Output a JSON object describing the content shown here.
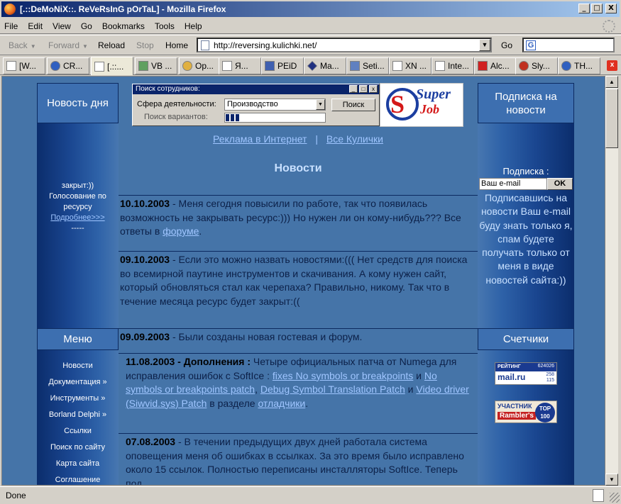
{
  "window": {
    "title": "[.::DeMoNiX::. ReVeRsInG pOrTaL] - Mozilla Firefox",
    "minimize": "_",
    "maximize": "□",
    "close": "X"
  },
  "menu": [
    "File",
    "Edit",
    "View",
    "Go",
    "Bookmarks",
    "Tools",
    "Help"
  ],
  "nav": {
    "back": "Back",
    "forward": "Forward",
    "reload": "Reload",
    "stop": "Stop",
    "home": "Home",
    "url": "http://reversing.kulichki.net/",
    "go": "Go",
    "search_placeholder": ""
  },
  "tabs": [
    {
      "label": "[W...",
      "icon": "page-icon"
    },
    {
      "label": "CR...",
      "icon": "globe-icon"
    },
    {
      "label": "[.::...",
      "icon": "page-icon",
      "active": true
    },
    {
      "label": "VB ...",
      "icon": "vb-icon"
    },
    {
      "label": "Op...",
      "icon": "gear-icon"
    },
    {
      "label": "Я...",
      "icon": "page-icon"
    },
    {
      "label": "PEiD",
      "icon": "app-icon"
    },
    {
      "label": "Ma...",
      "icon": "diamond-icon"
    },
    {
      "label": "Seti...",
      "icon": "telescope-icon"
    },
    {
      "label": "XN ...",
      "icon": "page-icon"
    },
    {
      "label": "Inte...",
      "icon": "page-icon"
    },
    {
      "label": "Alc...",
      "icon": "pdf-icon"
    },
    {
      "label": "Sly...",
      "icon": "firefox-icon"
    },
    {
      "label": "TH...",
      "icon": "globe-icon"
    }
  ],
  "status": "Done",
  "page": {
    "left": {
      "news_day": "Новость дня",
      "poll_lines": [
        "закрыт:))",
        "Голосование по",
        "ресурсу"
      ],
      "poll_more": "Подробнее>>>",
      "poll_sep": "-----",
      "menu_title": "Меню",
      "menu_items": [
        "Новости",
        "Документация »",
        "Инструменты »",
        "Borland Delphi »",
        "Ссылки",
        "Поиск по сайту",
        "Карта сайта",
        "Соглашение"
      ]
    },
    "widget": {
      "title": "Поиск сотрудников:",
      "sphere_label": "Сфера деятельности:",
      "sphere_value": "Производство",
      "search_button": "Поиск",
      "variants_label": "Поиск вариантов:",
      "progress": 0.14
    },
    "logo": {
      "super": "Super",
      "job": "Job",
      "s": "S"
    },
    "mid": {
      "top_links": [
        "Реклама в Интернет",
        "Все Кулички"
      ],
      "separator": "|",
      "news_title": "Новости",
      "news": [
        {
          "date": "10.10.2003",
          "parts": [
            " - Меня сегодня повысили по работе, так что появилась возможность не закрывать ресурс:))) Но нужен ли он кому-нибудь??? Все ответы в ",
            {
              "link": "форуме"
            },
            "."
          ]
        },
        {
          "date": "09.10.2003",
          "parts": [
            " - Если это можно назвать новостями:((( Нет средств для поиска во всемирной паутине инструментов и скачивания. А кому нужен сайт, который обновляться стал  как черепаха? Правильно, никому. Так что в течение месяца ресурс будет закрыт:(("
          ]
        },
        {
          "date": "09.09.2003",
          "parts": [
            " - Были созданы новая гостевая и форум."
          ]
        },
        {
          "date": "11.08.2003 - Дополнения :",
          "parts": [
            " Четыре официальных патча от Numega для исправления ошибок с SoftIce : ",
            {
              "link": "fixes No symbols or breakpoints"
            },
            " и ",
            {
              "link": "No symbols or breakpoints patch"
            },
            ", ",
            {
              "link": "Debug Symbol Translation Patch"
            },
            " и ",
            {
              "link": "Video driver (Siwvid.sys) Patch"
            },
            " в разделе ",
            {
              "link": "отладчики"
            },
            "."
          ]
        },
        {
          "date": "07.08.2003",
          "parts": [
            " - В течении предыдущих двух дней работала система оповещения меня об ошибках в ссылках. За это время было исправлено около 15 ссылок. Полностью переписаны инсталляторы SoftIce. Теперь под"
          ]
        }
      ]
    },
    "right": {
      "subscribe_title": "Подписка на новости",
      "subscribe_label": "Подписка :",
      "email_value": "Ваш e-mail",
      "ok": "OK",
      "note": "Подписавшись на новости Ваш e-mail буду знать только я, спам будете получать только от меня в виде новостей сайта:))",
      "counters_title": "Счетчики",
      "counter_mail": {
        "label": "РЕЙТИНГ",
        "brand": "mail.ru",
        "n1": "624026",
        "n2": "258",
        "n3": "115"
      },
      "counter_rambler": {
        "label": "УЧАСТНИК",
        "brand": "Rambler's",
        "top": "TOP 100"
      }
    }
  }
}
